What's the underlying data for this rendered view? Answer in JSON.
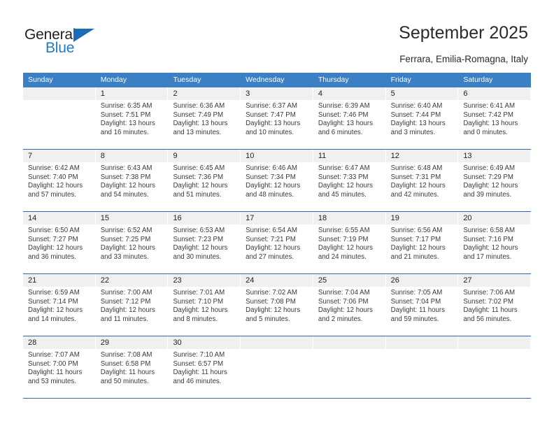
{
  "brand": {
    "name_part1": "General",
    "name_part2": "Blue"
  },
  "header": {
    "title": "September 2025",
    "subtitle": "Ferrara, Emilia-Romagna, Italy"
  },
  "weekday_headers": [
    "Sunday",
    "Monday",
    "Tuesday",
    "Wednesday",
    "Thursday",
    "Friday",
    "Saturday"
  ],
  "colors": {
    "header_blue": "#3b7fc4",
    "separator_blue": "#2f6aa8",
    "date_band_gray": "#f0f0f0",
    "logo_blue": "#1f7bc4",
    "text_dark": "#2b2b2b"
  },
  "weeks": [
    [
      {
        "day": "",
        "empty": true
      },
      {
        "day": "1",
        "sunrise": "Sunrise: 6:35 AM",
        "sunset": "Sunset: 7:51 PM",
        "daylight": "Daylight: 13 hours and 16 minutes."
      },
      {
        "day": "2",
        "sunrise": "Sunrise: 6:36 AM",
        "sunset": "Sunset: 7:49 PM",
        "daylight": "Daylight: 13 hours and 13 minutes."
      },
      {
        "day": "3",
        "sunrise": "Sunrise: 6:37 AM",
        "sunset": "Sunset: 7:47 PM",
        "daylight": "Daylight: 13 hours and 10 minutes."
      },
      {
        "day": "4",
        "sunrise": "Sunrise: 6:39 AM",
        "sunset": "Sunset: 7:46 PM",
        "daylight": "Daylight: 13 hours and 6 minutes."
      },
      {
        "day": "5",
        "sunrise": "Sunrise: 6:40 AM",
        "sunset": "Sunset: 7:44 PM",
        "daylight": "Daylight: 13 hours and 3 minutes."
      },
      {
        "day": "6",
        "sunrise": "Sunrise: 6:41 AM",
        "sunset": "Sunset: 7:42 PM",
        "daylight": "Daylight: 13 hours and 0 minutes."
      }
    ],
    [
      {
        "day": "7",
        "sunrise": "Sunrise: 6:42 AM",
        "sunset": "Sunset: 7:40 PM",
        "daylight": "Daylight: 12 hours and 57 minutes."
      },
      {
        "day": "8",
        "sunrise": "Sunrise: 6:43 AM",
        "sunset": "Sunset: 7:38 PM",
        "daylight": "Daylight: 12 hours and 54 minutes."
      },
      {
        "day": "9",
        "sunrise": "Sunrise: 6:45 AM",
        "sunset": "Sunset: 7:36 PM",
        "daylight": "Daylight: 12 hours and 51 minutes."
      },
      {
        "day": "10",
        "sunrise": "Sunrise: 6:46 AM",
        "sunset": "Sunset: 7:34 PM",
        "daylight": "Daylight: 12 hours and 48 minutes."
      },
      {
        "day": "11",
        "sunrise": "Sunrise: 6:47 AM",
        "sunset": "Sunset: 7:33 PM",
        "daylight": "Daylight: 12 hours and 45 minutes."
      },
      {
        "day": "12",
        "sunrise": "Sunrise: 6:48 AM",
        "sunset": "Sunset: 7:31 PM",
        "daylight": "Daylight: 12 hours and 42 minutes."
      },
      {
        "day": "13",
        "sunrise": "Sunrise: 6:49 AM",
        "sunset": "Sunset: 7:29 PM",
        "daylight": "Daylight: 12 hours and 39 minutes."
      }
    ],
    [
      {
        "day": "14",
        "sunrise": "Sunrise: 6:50 AM",
        "sunset": "Sunset: 7:27 PM",
        "daylight": "Daylight: 12 hours and 36 minutes."
      },
      {
        "day": "15",
        "sunrise": "Sunrise: 6:52 AM",
        "sunset": "Sunset: 7:25 PM",
        "daylight": "Daylight: 12 hours and 33 minutes."
      },
      {
        "day": "16",
        "sunrise": "Sunrise: 6:53 AM",
        "sunset": "Sunset: 7:23 PM",
        "daylight": "Daylight: 12 hours and 30 minutes."
      },
      {
        "day": "17",
        "sunrise": "Sunrise: 6:54 AM",
        "sunset": "Sunset: 7:21 PM",
        "daylight": "Daylight: 12 hours and 27 minutes."
      },
      {
        "day": "18",
        "sunrise": "Sunrise: 6:55 AM",
        "sunset": "Sunset: 7:19 PM",
        "daylight": "Daylight: 12 hours and 24 minutes."
      },
      {
        "day": "19",
        "sunrise": "Sunrise: 6:56 AM",
        "sunset": "Sunset: 7:17 PM",
        "daylight": "Daylight: 12 hours and 21 minutes."
      },
      {
        "day": "20",
        "sunrise": "Sunrise: 6:58 AM",
        "sunset": "Sunset: 7:16 PM",
        "daylight": "Daylight: 12 hours and 17 minutes."
      }
    ],
    [
      {
        "day": "21",
        "sunrise": "Sunrise: 6:59 AM",
        "sunset": "Sunset: 7:14 PM",
        "daylight": "Daylight: 12 hours and 14 minutes."
      },
      {
        "day": "22",
        "sunrise": "Sunrise: 7:00 AM",
        "sunset": "Sunset: 7:12 PM",
        "daylight": "Daylight: 12 hours and 11 minutes."
      },
      {
        "day": "23",
        "sunrise": "Sunrise: 7:01 AM",
        "sunset": "Sunset: 7:10 PM",
        "daylight": "Daylight: 12 hours and 8 minutes."
      },
      {
        "day": "24",
        "sunrise": "Sunrise: 7:02 AM",
        "sunset": "Sunset: 7:08 PM",
        "daylight": "Daylight: 12 hours and 5 minutes."
      },
      {
        "day": "25",
        "sunrise": "Sunrise: 7:04 AM",
        "sunset": "Sunset: 7:06 PM",
        "daylight": "Daylight: 12 hours and 2 minutes."
      },
      {
        "day": "26",
        "sunrise": "Sunrise: 7:05 AM",
        "sunset": "Sunset: 7:04 PM",
        "daylight": "Daylight: 11 hours and 59 minutes."
      },
      {
        "day": "27",
        "sunrise": "Sunrise: 7:06 AM",
        "sunset": "Sunset: 7:02 PM",
        "daylight": "Daylight: 11 hours and 56 minutes."
      }
    ],
    [
      {
        "day": "28",
        "sunrise": "Sunrise: 7:07 AM",
        "sunset": "Sunset: 7:00 PM",
        "daylight": "Daylight: 11 hours and 53 minutes."
      },
      {
        "day": "29",
        "sunrise": "Sunrise: 7:08 AM",
        "sunset": "Sunset: 6:58 PM",
        "daylight": "Daylight: 11 hours and 50 minutes."
      },
      {
        "day": "30",
        "sunrise": "Sunrise: 7:10 AM",
        "sunset": "Sunset: 6:57 PM",
        "daylight": "Daylight: 11 hours and 46 minutes."
      },
      {
        "day": "",
        "empty": true
      },
      {
        "day": "",
        "empty": true
      },
      {
        "day": "",
        "empty": true
      },
      {
        "day": "",
        "empty": true
      }
    ]
  ]
}
